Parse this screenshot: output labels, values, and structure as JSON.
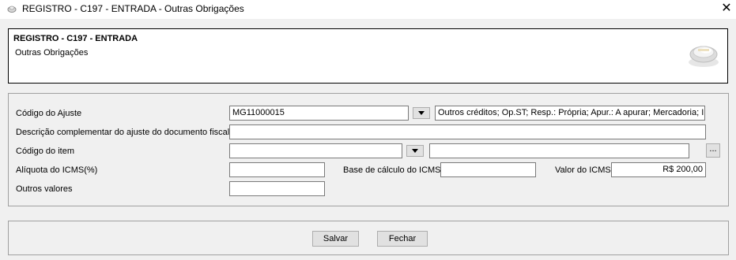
{
  "window": {
    "title": "REGISTRO - C197 - ENTRADA - Outras Obrigações",
    "close_glyph": "✕"
  },
  "header": {
    "title": "REGISTRO - C197 - ENTRADA",
    "subtitle": "Outras Obrigações"
  },
  "form": {
    "codigo_ajuste": {
      "label": "Código do Ajuste",
      "value": "MG11000015",
      "description": "Outros créditos; Op.ST; Resp.: Própria; Apur.: A apurar; Mercadoria; I"
    },
    "descricao_complementar": {
      "label": "Descrição complementar do ajuste do documento fiscal",
      "value": ""
    },
    "codigo_item": {
      "label": "Código do item",
      "value": "",
      "description": "",
      "ellipsis": "..."
    },
    "aliquota_icms": {
      "label": "Alíquota do ICMS(%)",
      "value": ""
    },
    "base_calculo_icms": {
      "label": "Base de cálculo do ICMS",
      "value": ""
    },
    "valor_icms": {
      "label": "Valor do ICMS",
      "value": "R$ 200,00"
    },
    "outros_valores": {
      "label": "Outros valores",
      "value": ""
    }
  },
  "footer": {
    "save_label": "Salvar",
    "close_label": "Fechar"
  },
  "icons": {
    "app": "app-icon",
    "logo": "disc-logo-icon",
    "dropdown": "chevron-down-icon"
  }
}
